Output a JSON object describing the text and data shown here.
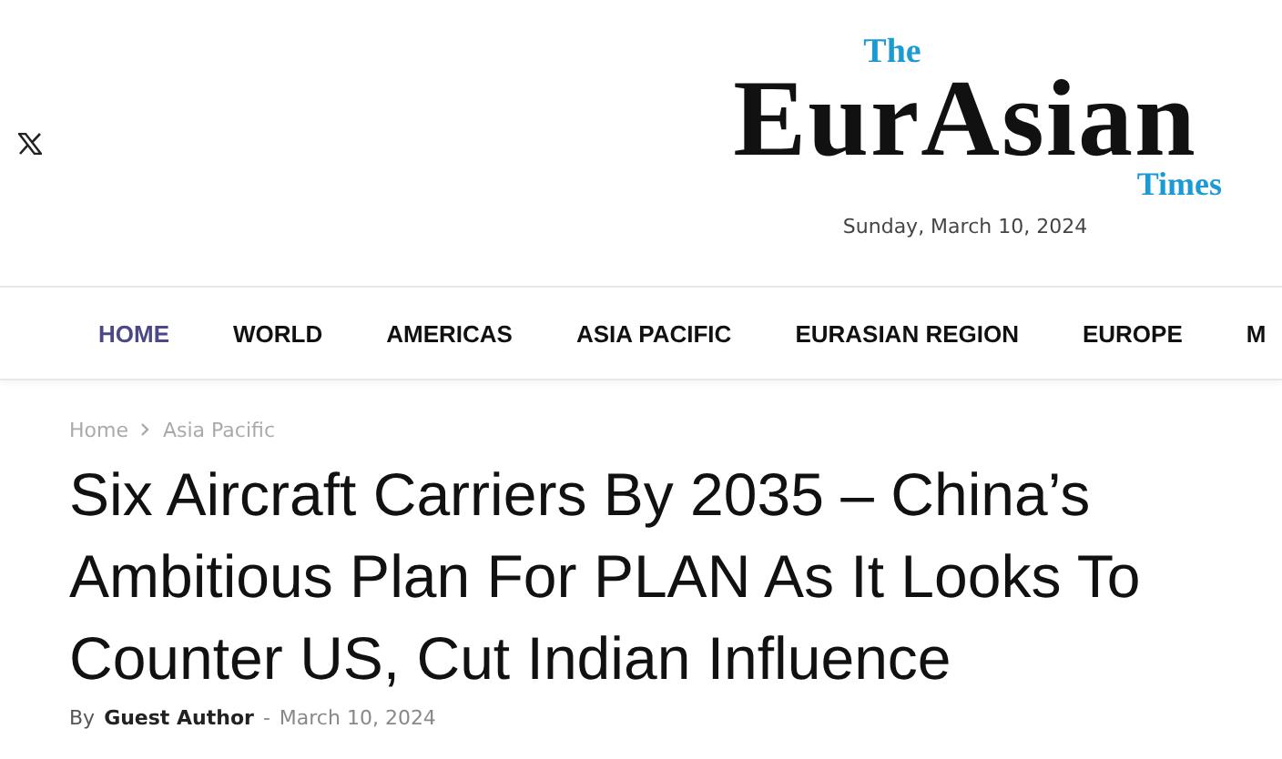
{
  "header": {
    "social": [
      {
        "kind": "x"
      }
    ],
    "logo": {
      "top": "The",
      "main": "EurAsian",
      "bottom": "Times"
    },
    "date": "Sunday, March 10, 2024"
  },
  "nav": [
    {
      "label": "HOME",
      "selected": true
    },
    {
      "label": "WORLD",
      "selected": false
    },
    {
      "label": "AMERICAS",
      "selected": false
    },
    {
      "label": "ASIA PACIFIC",
      "selected": false
    },
    {
      "label": "EURASIAN REGION",
      "selected": false
    },
    {
      "label": "EUROPE",
      "selected": false
    },
    {
      "label": "M",
      "selected": false
    }
  ],
  "breadcrumb": [
    "Home",
    "Asia Pacific"
  ],
  "article": {
    "title": "Six Aircraft Carriers By 2035 – China’s Ambitious Plan For PLAN As It Looks To Counter US, Cut Indian Influence",
    "by": "By",
    "author": "Guest Author",
    "separator": "-",
    "date": "March 10, 2024"
  }
}
